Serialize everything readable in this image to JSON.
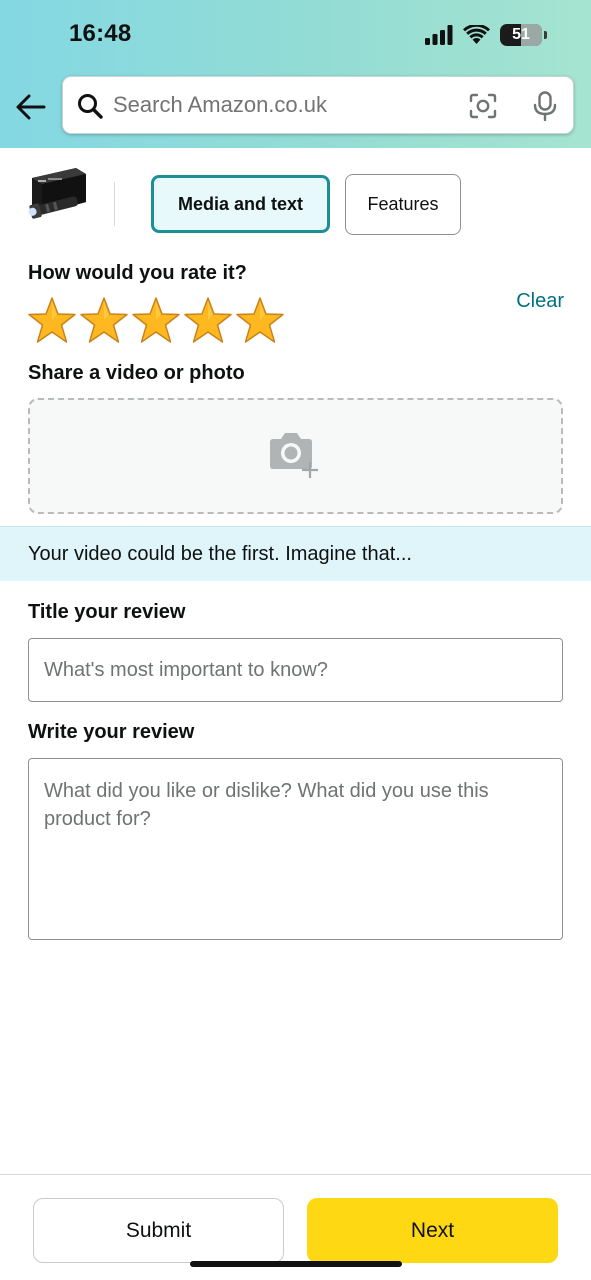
{
  "status_bar": {
    "time": "16:48",
    "battery_percent": "51",
    "icons": [
      "cellular-signal-icon",
      "wifi-icon",
      "battery-icon"
    ]
  },
  "search": {
    "placeholder": "Search Amazon.co.uk",
    "icons": [
      "back-arrow-icon",
      "search-icon",
      "camera-lens-icon",
      "microphone-icon"
    ]
  },
  "tabs": [
    {
      "label": "Media and text",
      "selected": true
    },
    {
      "label": "Features",
      "selected": false
    }
  ],
  "rating": {
    "heading": "How would you rate it?",
    "clear_label": "Clear",
    "stars_filled": 5,
    "stars_total": 5
  },
  "media": {
    "heading": "Share a video or photo",
    "banner_text": "Your video could be the first. Imagine that..."
  },
  "title_section": {
    "heading": "Title your review",
    "placeholder": "What's most important to know?"
  },
  "review_section": {
    "heading": "Write your review",
    "placeholder": "What did you like or dislike? What did you use this product for?"
  },
  "actions": {
    "submit_label": "Submit",
    "next_label": "Next"
  },
  "colors": {
    "accent_teal": "#007185",
    "tab_selected_border": "#1b8e98",
    "star_gold": "#ffa41c",
    "next_button": "#ffd814",
    "banner_bg": "#dff5fa"
  }
}
